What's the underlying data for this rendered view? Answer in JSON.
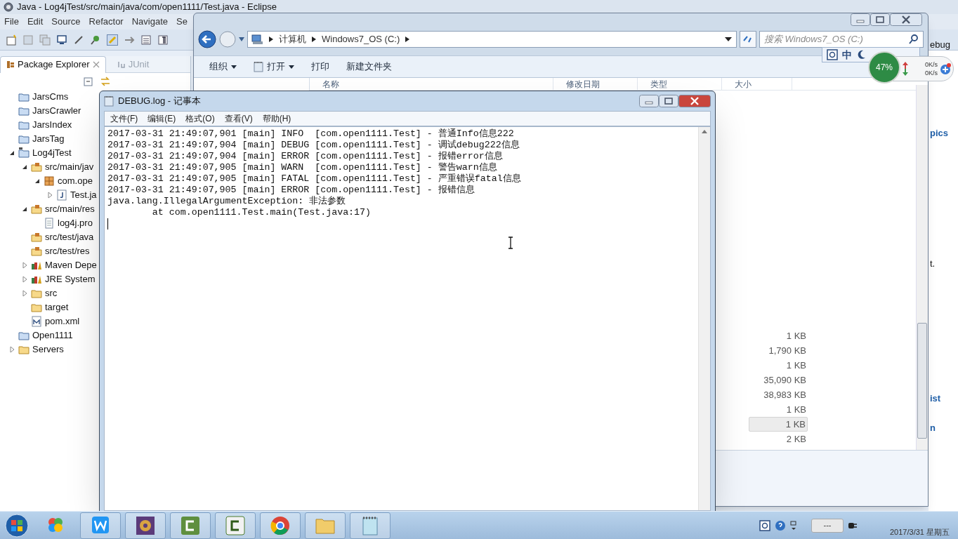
{
  "eclipse": {
    "title": "Java - Log4jTest/src/main/java/com/open1111/Test.java - Eclipse",
    "menu": [
      "File",
      "Edit",
      "Source",
      "Refactor",
      "Navigate",
      "Se"
    ],
    "views": [
      {
        "label": "Package Explorer",
        "selected": true,
        "closable": true
      },
      {
        "label": "JUnit",
        "selected": false,
        "closable": false
      }
    ],
    "tree": [
      {
        "label": "JarsCms",
        "kind": "project"
      },
      {
        "label": "JarsCrawler",
        "kind": "project"
      },
      {
        "label": "JarsIndex",
        "kind": "project"
      },
      {
        "label": "JarsTag",
        "kind": "project"
      },
      {
        "label": "Log4jTest",
        "kind": "maven-project",
        "expanded": true,
        "children": [
          {
            "label": "src/main/jav",
            "kind": "source-folder",
            "expanded": true,
            "children": [
              {
                "label": "com.ope",
                "kind": "package",
                "expanded": true,
                "children": [
                  {
                    "label": "Test.ja",
                    "kind": "java-file",
                    "expanded": false
                  }
                ]
              }
            ]
          },
          {
            "label": "src/main/res",
            "kind": "source-folder",
            "expanded": true,
            "children": [
              {
                "label": "log4j.pro",
                "kind": "file"
              }
            ]
          },
          {
            "label": "src/test/java",
            "kind": "source-folder"
          },
          {
            "label": "src/test/res",
            "kind": "source-folder"
          },
          {
            "label": "Maven Depe",
            "kind": "library",
            "expanded": false
          },
          {
            "label": "JRE System",
            "kind": "library",
            "expanded": false
          },
          {
            "label": "src",
            "kind": "folder",
            "expanded": false
          },
          {
            "label": "target",
            "kind": "folder"
          },
          {
            "label": "pom.xml",
            "kind": "xml"
          }
        ]
      },
      {
        "label": "Open1111",
        "kind": "project"
      },
      {
        "label": "Servers",
        "kind": "folder",
        "expanded": false
      }
    ],
    "side_fragments": [
      "ebug",
      "pics",
      "t.",
      "ist",
      "n"
    ]
  },
  "explorer": {
    "breadcrumb": [
      "计算机",
      "Windows7_OS (C:)"
    ],
    "search": {
      "placeholder": "搜索 Windows7_OS (C:)"
    },
    "toolbar": [
      {
        "label": "组织",
        "dropdown": true,
        "kind": "plain"
      },
      {
        "label": "打开",
        "dropdown": true,
        "kind": "notepad"
      },
      {
        "label": "打印",
        "dropdown": false,
        "kind": "plain"
      },
      {
        "label": "新建文件夹",
        "dropdown": false,
        "kind": "plain"
      }
    ],
    "columns": [
      "名称",
      "修改日期",
      "类型",
      "大小"
    ],
    "sizes": [
      {
        "text": "1 KB",
        "selected": false
      },
      {
        "text": "1,790 KB",
        "selected": false
      },
      {
        "text": "1 KB",
        "selected": false
      },
      {
        "text": "35,090 KB",
        "selected": false
      },
      {
        "text": "38,983 KB",
        "selected": false
      },
      {
        "text": "1 KB",
        "selected": false
      },
      {
        "text": "1 KB",
        "selected": true
      },
      {
        "text": "2 KB",
        "selected": false
      }
    ]
  },
  "notepad": {
    "title": "DEBUG.log - 记事本",
    "menu": [
      "文件(F)",
      "编辑(E)",
      "格式(O)",
      "查看(V)",
      "帮助(H)"
    ],
    "lines": [
      "2017-03-31 21:49:07,901 [main] INFO  [com.open1111.Test] - 普通Info信息222",
      "2017-03-31 21:49:07,904 [main] DEBUG [com.open1111.Test] - 调试debug222信息",
      "2017-03-31 21:49:07,904 [main] ERROR [com.open1111.Test] - 报错error信息",
      "2017-03-31 21:49:07,905 [main] WARN  [com.open1111.Test] - 警告warn信息",
      "2017-03-31 21:49:07,905 [main] FATAL [com.open1111.Test] - 严重错误fatal信息",
      "2017-03-31 21:49:07,905 [main] ERROR [com.open1111.Test] - 报错信息",
      "java.lang.IllegalArgumentException: 非法参数",
      "        at com.open1111.Test.main(Test.java:17)"
    ]
  },
  "ime": {
    "mode": "中"
  },
  "monitor": {
    "percent": "47%",
    "upload": "0K/s",
    "download": "0K/s"
  },
  "taskbar": {
    "apps": [
      {
        "kind": "petals"
      },
      {
        "kind": "wps"
      },
      {
        "kind": "ide"
      },
      {
        "kind": "recorder"
      },
      {
        "kind": "recorder-alt"
      },
      {
        "kind": "chrome"
      },
      {
        "kind": "folder"
      },
      {
        "kind": "notepad"
      }
    ],
    "battery": "---",
    "date": "2017/3/31 星期五"
  }
}
